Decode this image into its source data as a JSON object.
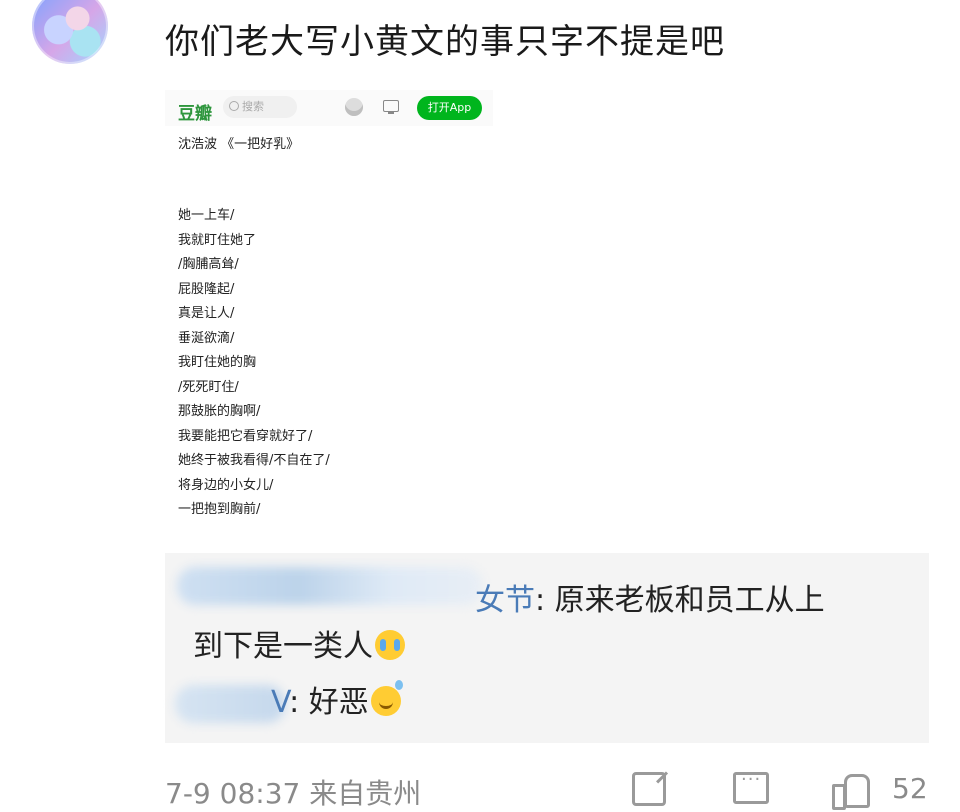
{
  "post": {
    "text": "你们老大写小黄文的事只字不提是吧"
  },
  "embedded_screenshot": {
    "app_logo": "豆瓣",
    "search_placeholder": "搜索",
    "open_app_button": "打开App",
    "title": "沈浩波 《一把好乳》",
    "lines": [
      "她一上车/",
      "我就盯住她了",
      "/胸脯高耸/",
      "屁股隆起/",
      "真是让人/",
      "垂涎欲滴/",
      "我盯住她的胸",
      "/死死盯住/",
      "那鼓胀的胸啊/",
      "我要能把它看穿就好了/",
      "她终于被我看得/不自在了/",
      "将身边的小女儿/",
      "一把抱到胸前/"
    ]
  },
  "comments": [
    {
      "nick_visible": "女节",
      "text_line1": ": 原来老板和员工从上",
      "text_line2": "到下是一类人",
      "emoji": "crying-laughing"
    },
    {
      "nick_visible": "V",
      "text": ": 好恶",
      "emoji": "sweat-smile"
    }
  ],
  "footer": {
    "meta": "7-9 08:37 来自贵州",
    "like_count": "52"
  },
  "colors": {
    "nick": "#4a7bb7",
    "douban_green": "#2e963d",
    "open_app_green": "#00b51d",
    "comment_bg": "#f4f4f4",
    "meta_gray": "#8a8a8a"
  }
}
